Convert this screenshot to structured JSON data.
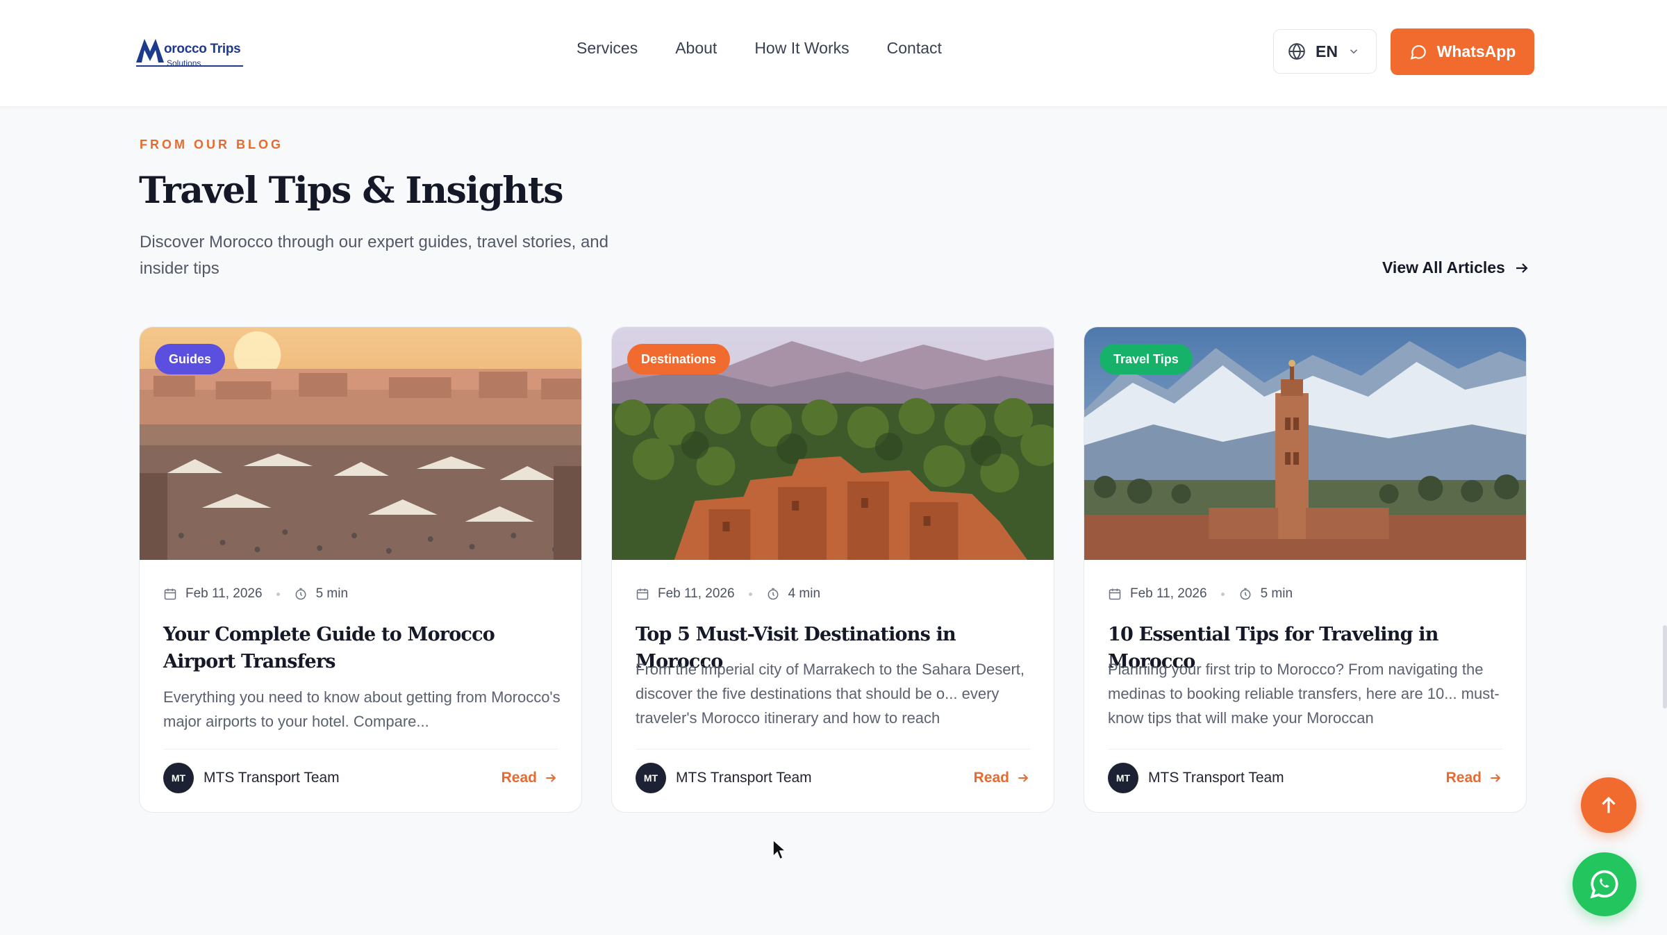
{
  "brand": {
    "name": "orocco Trips",
    "sub": "Solutions",
    "color": "#1e3a8a"
  },
  "nav": {
    "items": [
      {
        "label": "Services"
      },
      {
        "label": "About"
      },
      {
        "label": "How It Works"
      },
      {
        "label": "Contact"
      }
    ]
  },
  "header": {
    "language": "EN",
    "whatsapp_label": "WhatsApp",
    "accent": "#f26b2e"
  },
  "section": {
    "eyebrow": "FROM OUR BLOG",
    "title": "Travel Tips & Insights",
    "description": "Discover Morocco through our expert guides, travel stories, and insider tips",
    "view_all": "View All Articles"
  },
  "cards": [
    {
      "badge": "Guides",
      "badge_color": "#5b4fe0",
      "date": "Feb 11, 2026",
      "read_time": "5 min",
      "title": "Your Complete Guide to Morocco Airport Transfers",
      "excerpt": "Everything you need to know about getting from Morocco's major airports to your hotel. Compare...",
      "author_initials": "MT",
      "author": "MTS Transport Team",
      "read_label": "Read"
    },
    {
      "badge": "Destinations",
      "badge_color": "#f26b2e",
      "date": "Feb 11, 2026",
      "read_time": "4 min",
      "title": "Top 5 Must-Visit Destinations in Morocco",
      "excerpt": "From the imperial city of Marrakech to the Sahara Desert, discover the five destinations that should be o... every traveler's Morocco itinerary and how to reach",
      "author_initials": "MT",
      "author": "MTS Transport Team",
      "read_label": "Read"
    },
    {
      "badge": "Travel Tips",
      "badge_color": "#16b26a",
      "date": "Feb 11, 2026",
      "read_time": "5 min",
      "title": "10 Essential Tips for Traveling in Morocco",
      "excerpt": "Planning your first trip to Morocco? From navigating the medinas to booking reliable transfers, here are 10... must-know tips that will make your Moroccan",
      "author_initials": "MT",
      "author": "MTS Transport Team",
      "read_label": "Read"
    }
  ],
  "icons": {
    "globe": "globe-icon",
    "chevron": "chevron-down-icon",
    "chat": "chat-bubble-icon",
    "arrow_right": "arrow-right-icon",
    "calendar": "calendar-icon",
    "timer": "timer-icon",
    "arrow_up": "arrow-up-icon",
    "whatsapp": "whatsapp-icon"
  }
}
